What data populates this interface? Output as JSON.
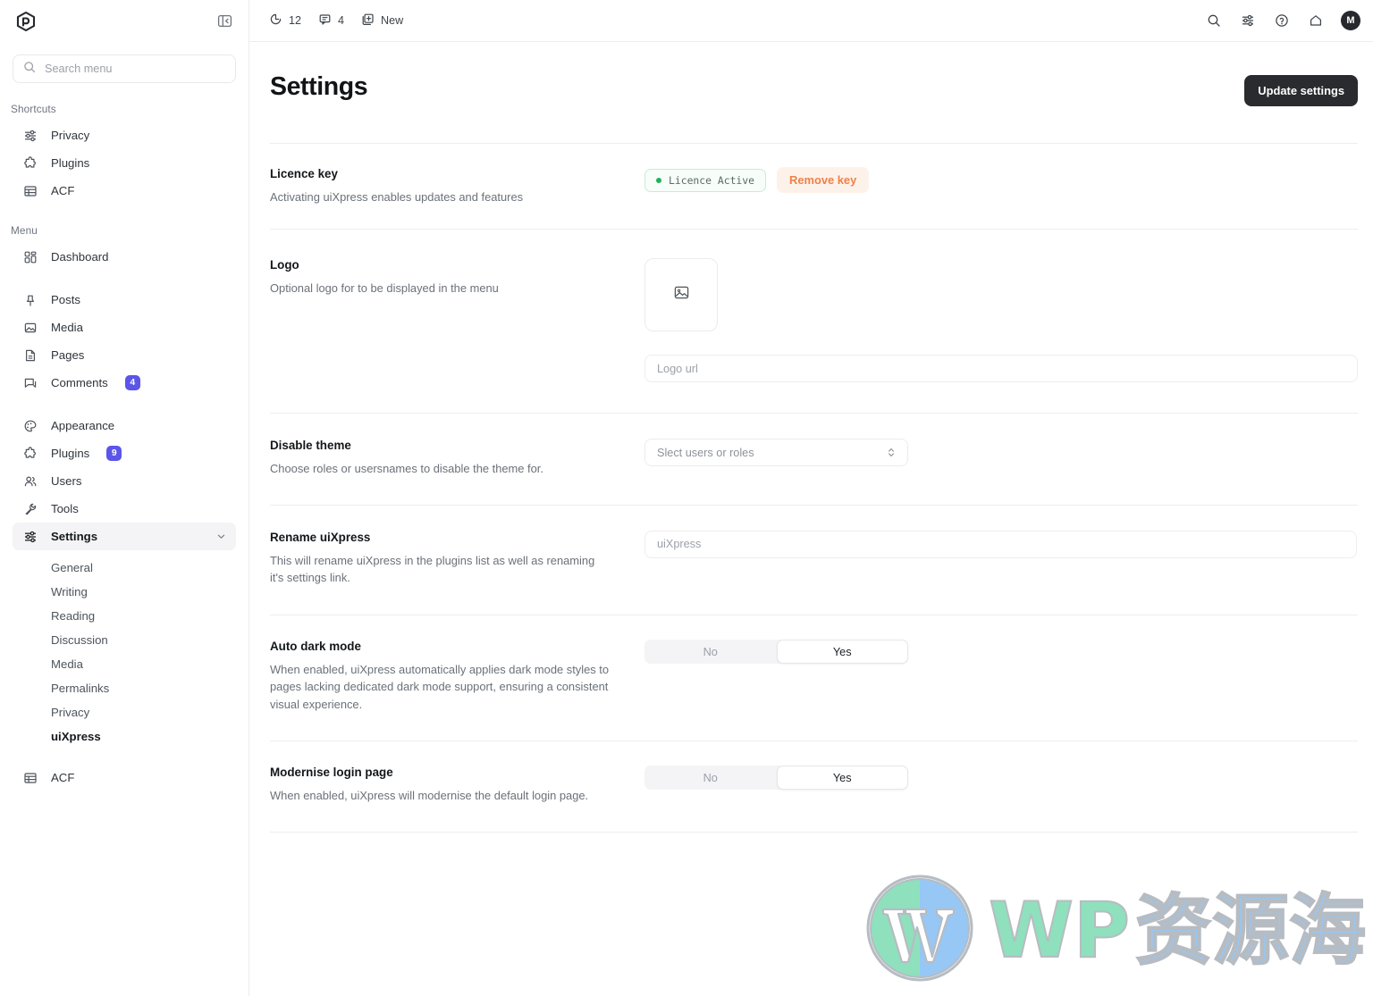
{
  "sidebar": {
    "logo_icon": "cube-logo-icon",
    "collapse_icon": "panel-collapse-icon",
    "search": {
      "placeholder": "Search menu",
      "value": "",
      "icon": "search-icon"
    },
    "shortcuts_label": "Shortcuts",
    "shortcuts": [
      {
        "label": "Privacy",
        "icon": "sliders-icon"
      },
      {
        "label": "Plugins",
        "icon": "puzzle-icon"
      },
      {
        "label": "ACF",
        "icon": "table-icon"
      }
    ],
    "menu_label": "Menu",
    "menu_group_1": [
      {
        "label": "Dashboard",
        "icon": "dashboard-grid-icon"
      }
    ],
    "menu_group_2": [
      {
        "label": "Posts",
        "icon": "pin-icon",
        "badge": ""
      },
      {
        "label": "Media",
        "icon": "image-icon",
        "badge": ""
      },
      {
        "label": "Pages",
        "icon": "page-icon",
        "badge": ""
      },
      {
        "label": "Comments",
        "icon": "comment-icon",
        "badge": "4"
      }
    ],
    "menu_group_3": [
      {
        "label": "Appearance",
        "icon": "palette-icon",
        "badge": ""
      },
      {
        "label": "Plugins",
        "icon": "puzzle-icon",
        "badge": "9"
      },
      {
        "label": "Users",
        "icon": "users-icon",
        "badge": ""
      },
      {
        "label": "Tools",
        "icon": "wrench-icon",
        "badge": ""
      },
      {
        "label": "Settings",
        "icon": "sliders-icon",
        "badge": "",
        "active": true,
        "expanded": true
      }
    ],
    "settings_submenu": [
      {
        "label": "General"
      },
      {
        "label": "Writing"
      },
      {
        "label": "Reading"
      },
      {
        "label": "Discussion"
      },
      {
        "label": "Media"
      },
      {
        "label": "Permalinks"
      },
      {
        "label": "Privacy"
      },
      {
        "label": "uiXpress",
        "active": true
      }
    ],
    "menu_group_4": [
      {
        "label": "ACF",
        "icon": "table-icon"
      }
    ],
    "badge_color": "#5b55e8"
  },
  "topbar": {
    "updates": {
      "icon": "refresh-icon",
      "count": "12"
    },
    "comments": {
      "icon": "comment-icon",
      "count": "4"
    },
    "new": {
      "icon": "new-plus-icon",
      "label": "New"
    },
    "right_icons": [
      {
        "name": "search-icon"
      },
      {
        "name": "sliders-icon"
      },
      {
        "name": "help-circle-icon"
      },
      {
        "name": "home-icon"
      }
    ],
    "avatar_initial": "M"
  },
  "page": {
    "title": "Settings",
    "update_button": "Update settings"
  },
  "rows": {
    "licence": {
      "title": "Licence key",
      "desc": "Activating uiXpress enables updates and features",
      "badge_text": "Licence Active",
      "badge_dot_color": "#22b05e",
      "remove_button": "Remove key",
      "remove_button_color": "#f0804a"
    },
    "logo": {
      "title": "Logo",
      "desc": "Optional logo for to be displayed in the menu",
      "upload_icon": "image-placeholder-icon",
      "url_placeholder": "Logo url",
      "url_value": ""
    },
    "disable_theme": {
      "title": "Disable theme",
      "desc": "Choose roles or usersnames to disable the theme for.",
      "select_value": "Slect users or roles",
      "select_icon": "chevron-updown-icon"
    },
    "rename": {
      "title": "Rename uiXpress",
      "desc": "This will rename uiXpress in the plugins list as well as renaming it's settings link.",
      "placeholder": "uiXpress",
      "value": ""
    },
    "auto_dark": {
      "title": "Auto dark mode",
      "desc": "When enabled, uiXpress automatically applies dark mode styles to pages lacking dedicated dark mode support, ensuring a consistent visual experience.",
      "option_no": "No",
      "option_yes": "Yes",
      "selected": "Yes"
    },
    "modernise_login": {
      "title": "Modernise login page",
      "desc": "When enabled, uiXpress will modernise the default login page.",
      "option_no": "No",
      "option_yes": "Yes",
      "selected": "Yes"
    }
  },
  "watermark": {
    "logo_icon": "wordpress-logo-icon",
    "text_latin": "WP",
    "text_cjk": "资源海",
    "color_latin": "#8fe0bd",
    "color_cjk": "#96c7f5"
  }
}
